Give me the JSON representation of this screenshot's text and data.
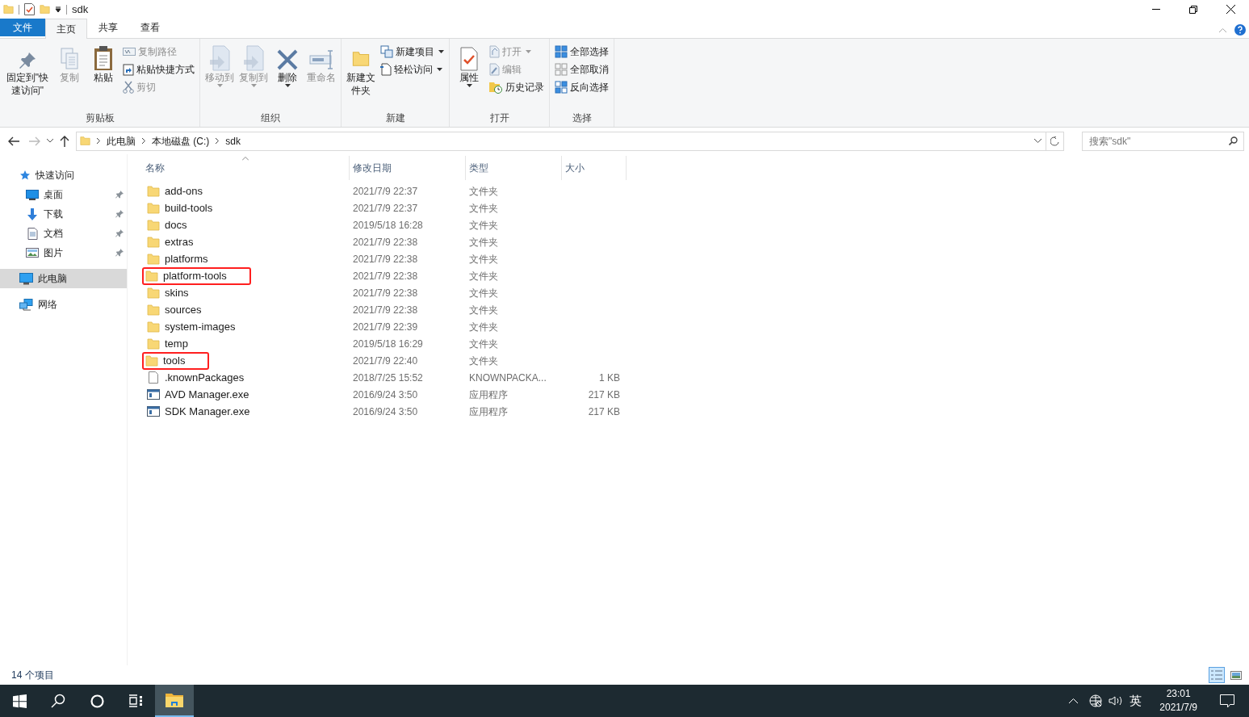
{
  "window": {
    "title": "sdk"
  },
  "ribbon_tabs": [
    {
      "label": "文件",
      "kind": "file"
    },
    {
      "label": "主页",
      "selected": true
    },
    {
      "label": "共享",
      "selected": false
    },
    {
      "label": "查看",
      "selected": false
    }
  ],
  "ribbon_groups": [
    {
      "label": "剪贴板",
      "large": [
        {
          "label": "固定到\"快速访问\"",
          "disabled": false,
          "dropdown": false
        },
        {
          "label": "复制",
          "disabled": true,
          "dropdown": false
        },
        {
          "label": "粘贴",
          "disabled": false,
          "dropdown": false
        }
      ],
      "small": [
        {
          "label": "复制路径",
          "disabled": true,
          "dropdown": false
        },
        {
          "label": "粘贴快捷方式",
          "disabled": false,
          "dropdown": false
        },
        {
          "label": "剪切",
          "disabled": true,
          "dropdown": false
        }
      ]
    },
    {
      "label": "组织",
      "large": [
        {
          "label": "移动到",
          "disabled": true,
          "dropdown": true
        },
        {
          "label": "复制到",
          "disabled": true,
          "dropdown": true
        },
        {
          "label": "删除",
          "disabled": false,
          "dropdown": true
        },
        {
          "label": "重命名",
          "disabled": true,
          "dropdown": false
        }
      ]
    },
    {
      "label": "新建",
      "large": [
        {
          "label": "新建文件夹",
          "disabled": false,
          "dropdown": false
        }
      ],
      "small": [
        {
          "label": "新建项目",
          "disabled": false,
          "dropdown": true
        },
        {
          "label": "轻松访问",
          "disabled": false,
          "dropdown": true
        }
      ]
    },
    {
      "label": "打开",
      "large": [
        {
          "label": "属性",
          "disabled": false,
          "dropdown": true
        }
      ],
      "small": [
        {
          "label": "打开",
          "disabled": true,
          "dropdown": true
        },
        {
          "label": "编辑",
          "disabled": true,
          "dropdown": false
        },
        {
          "label": "历史记录",
          "disabled": false,
          "dropdown": false
        }
      ]
    },
    {
      "label": "选择",
      "small": [
        {
          "label": "全部选择",
          "disabled": false,
          "dropdown": false
        },
        {
          "label": "全部取消",
          "disabled": false,
          "dropdown": false
        },
        {
          "label": "反向选择",
          "disabled": false,
          "dropdown": false
        }
      ]
    }
  ],
  "address": {
    "path": [
      "此电脑",
      "本地磁盘 (C:)",
      "sdk"
    ],
    "search_placeholder": "搜索\"sdk\""
  },
  "nav": [
    {
      "label": "快速访问",
      "kind": "star",
      "selected": false,
      "children": [
        {
          "label": "桌面",
          "kind": "desktop",
          "selected": false,
          "pinned": true
        },
        {
          "label": "下载",
          "kind": "download",
          "selected": false,
          "pinned": true
        },
        {
          "label": "文档",
          "kind": "document",
          "selected": false,
          "pinned": true
        },
        {
          "label": "图片",
          "kind": "pictures",
          "selected": false,
          "pinned": true
        }
      ]
    },
    {
      "label": "此电脑",
      "kind": "computer",
      "selected": true
    },
    {
      "label": "网络",
      "kind": "network",
      "selected": false
    }
  ],
  "columns": [
    {
      "label": "名称",
      "sorted": true
    },
    {
      "label": "修改日期",
      "sorted": false
    },
    {
      "label": "类型",
      "sorted": false
    },
    {
      "label": "大小",
      "sorted": false
    }
  ],
  "files": [
    {
      "name": "add-ons",
      "date": "2021/7/9 22:37",
      "type": "文件夹",
      "kind": "folder",
      "marked": false
    },
    {
      "name": "build-tools",
      "date": "2021/7/9 22:37",
      "type": "文件夹",
      "kind": "folder",
      "marked": false
    },
    {
      "name": "docs",
      "date": "2019/5/18 16:28",
      "type": "文件夹",
      "kind": "folder",
      "marked": false
    },
    {
      "name": "extras",
      "date": "2021/7/9 22:38",
      "type": "文件夹",
      "kind": "folder",
      "marked": false
    },
    {
      "name": "platforms",
      "date": "2021/7/9 22:38",
      "type": "文件夹",
      "kind": "folder",
      "marked": false
    },
    {
      "name": "platform-tools",
      "date": "2021/7/9 22:38",
      "type": "文件夹",
      "kind": "folder",
      "marked": true
    },
    {
      "name": "skins",
      "date": "2021/7/9 22:38",
      "type": "文件夹",
      "kind": "folder",
      "marked": false
    },
    {
      "name": "sources",
      "date": "2021/7/9 22:38",
      "type": "文件夹",
      "kind": "folder",
      "marked": false
    },
    {
      "name": "system-images",
      "date": "2021/7/9 22:39",
      "type": "文件夹",
      "kind": "folder",
      "marked": false
    },
    {
      "name": "temp",
      "date": "2019/5/18 16:29",
      "type": "文件夹",
      "kind": "folder",
      "marked": false
    },
    {
      "name": "tools",
      "date": "2021/7/9 22:40",
      "type": "文件夹",
      "kind": "folder",
      "marked": true
    },
    {
      "name": ".knownPackages",
      "date": "2018/7/25 15:52",
      "type": "KNOWNPACKA...",
      "size": "1 KB",
      "kind": "file",
      "marked": false
    },
    {
      "name": "AVD Manager.exe",
      "date": "2016/9/24 3:50",
      "type": "应用程序",
      "size": "217 KB",
      "kind": "exe",
      "marked": false
    },
    {
      "name": "SDK Manager.exe",
      "date": "2016/9/24 3:50",
      "type": "应用程序",
      "size": "217 KB",
      "kind": "exe",
      "marked": false
    }
  ],
  "status_bar": {
    "count": "14 个项目",
    "views": [
      {
        "kind": "details",
        "selected": true
      },
      {
        "kind": "large",
        "selected": false
      }
    ]
  },
  "taskbar": {
    "apps": [
      {
        "kind": "start",
        "active": false
      },
      {
        "kind": "search",
        "active": false
      },
      {
        "kind": "cortana",
        "active": false
      },
      {
        "kind": "taskview",
        "active": false
      },
      {
        "kind": "explorer",
        "active": true
      }
    ],
    "ime": "英",
    "time": "23:01",
    "date": "2021/7/9"
  }
}
